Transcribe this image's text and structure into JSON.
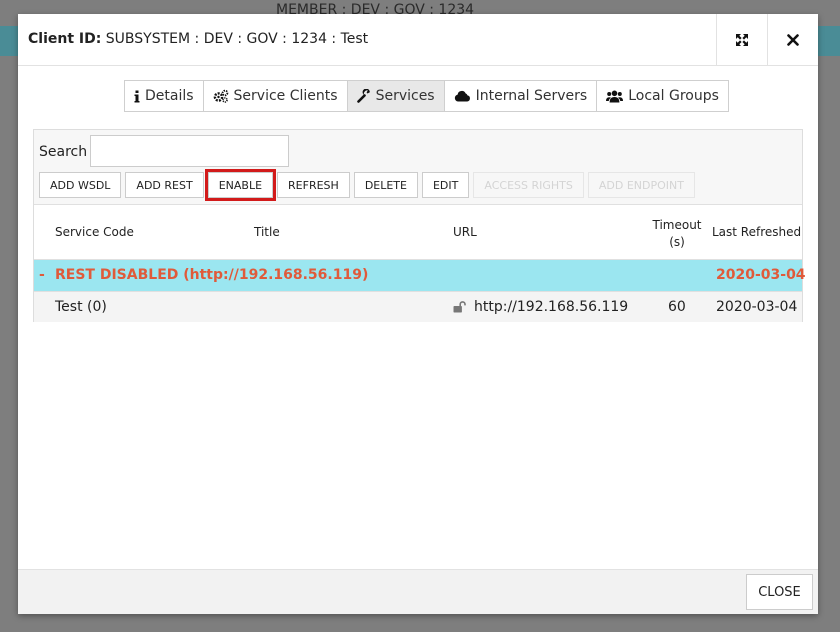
{
  "background": {
    "member_text": "MEMBER : DEV : GOV : 1234"
  },
  "dialog": {
    "title_label": "Client ID:",
    "title_value": "SUBSYSTEM : DEV : GOV : 1234 : Test",
    "expand_icon": "expand-icon",
    "close_icon": "close-icon"
  },
  "tabs": [
    {
      "label": "Details",
      "icon": "info-icon",
      "active": false
    },
    {
      "label": "Service Clients",
      "icon": "gears-icon",
      "active": false
    },
    {
      "label": "Services",
      "icon": "wrench-icon",
      "active": true
    },
    {
      "label": "Internal Servers",
      "icon": "cloud-icon",
      "active": false
    },
    {
      "label": "Local Groups",
      "icon": "users-icon",
      "active": false
    }
  ],
  "toolbar": {
    "search_label": "Search",
    "search_value": "",
    "buttons": [
      {
        "label": "ADD WSDL",
        "enabled": true
      },
      {
        "label": "ADD REST",
        "enabled": true
      },
      {
        "label": "ENABLE",
        "enabled": true,
        "highlighted": true
      },
      {
        "label": "REFRESH",
        "enabled": true
      },
      {
        "label": "DELETE",
        "enabled": true
      },
      {
        "label": "EDIT",
        "enabled": true
      },
      {
        "label": "ACCESS RIGHTS",
        "enabled": false
      },
      {
        "label": "ADD ENDPOINT",
        "enabled": false
      }
    ]
  },
  "table": {
    "headers": {
      "service_code": "Service Code",
      "title": "Title",
      "url": "URL",
      "timeout": "Timeout (s)",
      "last_refreshed": "Last Refreshed"
    },
    "group_row": {
      "toggle": "-",
      "name": "REST DISABLED (http://192.168.56.119)",
      "last_refreshed": "2020-03-04"
    },
    "rows": [
      {
        "service_code": "Test (0)",
        "title": "",
        "url": "http://192.168.56.119",
        "url_icon": "unlock-icon",
        "timeout": "60",
        "last_refreshed": "2020-03-04"
      }
    ]
  },
  "footer": {
    "close_label": "CLOSE"
  },
  "colors": {
    "group_row_bg": "#9be6f0",
    "group_row_text": "#e05a3a",
    "highlight_border": "#d21a1a"
  }
}
